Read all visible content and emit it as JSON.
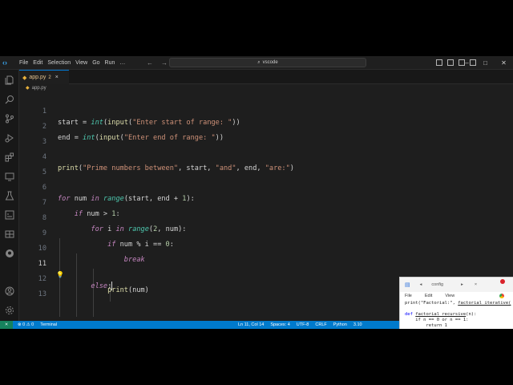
{
  "menu": [
    "File",
    "Edit",
    "Selection",
    "View",
    "Go",
    "Run",
    "…"
  ],
  "search": {
    "text": "vscode"
  },
  "tab": {
    "filename": "app.py",
    "badge": "2",
    "close": "×"
  },
  "breadcrumb": {
    "file": "app.py"
  },
  "editor": {
    "line_numbers": [
      "1",
      "2",
      "3",
      "4",
      "5",
      "6",
      "7",
      "8",
      "9",
      "10",
      "11",
      "12",
      "13"
    ],
    "active_line": "11"
  },
  "statusbar": {
    "remote": "⨯",
    "problems": "⊗ 0 ⚠ 0",
    "terminal": "Terminal",
    "position": "Ln 11, Col 14",
    "spaces": "Spaces: 4",
    "encoding": "UTF-8",
    "eol": "CRLF",
    "language": "Python",
    "version": "3.10"
  },
  "overlay": {
    "tab": "config",
    "menu": [
      "File",
      "Edit",
      "View"
    ],
    "line1_a": "print(\"Factorial:\", ",
    "line1_b": "factorial_iterative(",
    "line2_a": "def ",
    "line2_b": "factorial_recursive",
    "line2_c": "(n):",
    "line3": "    if n == 0 or n == 1:",
    "line4": "        return 1"
  },
  "colors": {
    "accent": "#007acc",
    "keyword": "#c586c0",
    "function": "#dcdcaa",
    "string": "#ce9178",
    "number": "#b5cea8",
    "builtin": "#4ec9b0"
  }
}
